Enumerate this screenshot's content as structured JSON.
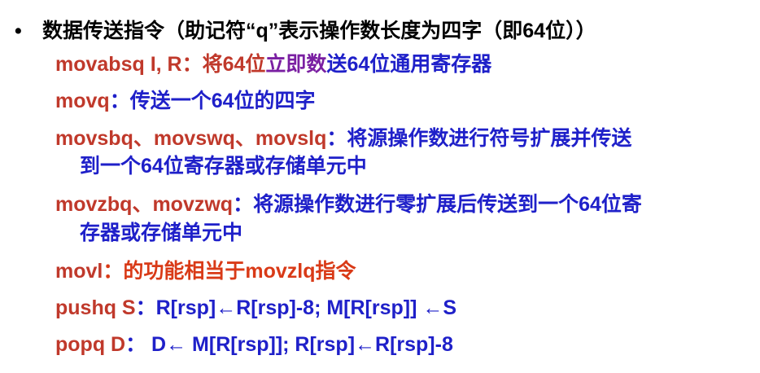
{
  "heading": {
    "bullet": "•",
    "text": "数据传送指令（助记符“q”表示操作数长度为四字（即64位））"
  },
  "items": [
    {
      "mnemonic": "movabsq I, R",
      "sep": "：",
      "desc_pre": "将64位",
      "desc_highlight": "立即数",
      "desc_post": "送64位通用寄存器"
    },
    {
      "mnemonic": "movq",
      "sep": "：",
      "desc": "传送一个64位的四字"
    },
    {
      "mnemonic": "movsbq、movswq、movslq",
      "sep": "：",
      "desc": "将源操作数进行符号扩展并传送",
      "desc_cont": "到一个64位寄存器或存储单元中"
    },
    {
      "mnemonic": "movzbq、movzwq",
      "sep": "：",
      "desc": "将源操作数进行零扩展后传送到一个64位寄",
      "desc_cont": "存器或存储单元中"
    },
    {
      "mnemonic": "movl",
      "sep": "：",
      "desc": "的功能相当于movzlq指令"
    },
    {
      "mnemonic": "pushq S",
      "sep": "：",
      "desc": "R[rsp]←R[rsp]-8; M[R[rsp]] ←S"
    },
    {
      "mnemonic": "popq D",
      "sep": "：",
      "desc": " D← M[R[rsp]]; R[rsp]←R[rsp]-8"
    }
  ],
  "colors": {
    "mnemonic": "#c0392b",
    "description": "#1f20c9",
    "highlight": "#7a1fa2",
    "movl_line": "#d93a17",
    "heading": "#000000"
  }
}
